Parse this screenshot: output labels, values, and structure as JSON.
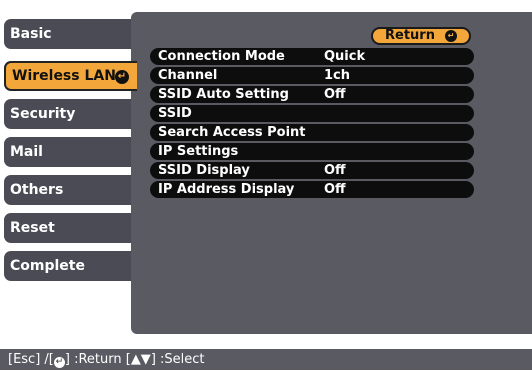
{
  "tabs": [
    {
      "label": "Basic"
    },
    {
      "label": "Wireless LAN",
      "selected": true
    },
    {
      "label": "Security"
    },
    {
      "label": "Mail"
    },
    {
      "label": "Others"
    },
    {
      "label": "Reset"
    },
    {
      "label": "Complete"
    }
  ],
  "return_button": {
    "label": "Return"
  },
  "rows": [
    {
      "label": "Connection Mode",
      "value": "Quick"
    },
    {
      "label": "Channel",
      "value": "1ch"
    },
    {
      "label": "SSID Auto Setting",
      "value": "Off"
    },
    {
      "label": "SSID",
      "value": ""
    },
    {
      "label": "Search Access Point",
      "value": ""
    },
    {
      "label": "IP Settings",
      "value": ""
    },
    {
      "label": "SSID Display",
      "value": "Off"
    },
    {
      "label": "IP Address Display",
      "value": "Off"
    }
  ],
  "status_bar": {
    "esc_key": "[Esc] /[",
    "return_text": "] :Return  [",
    "select_text": "] :Select"
  },
  "colors": {
    "accent": "#f3a73a",
    "panel": "#5a5a63",
    "tab": "#4b4b55"
  }
}
